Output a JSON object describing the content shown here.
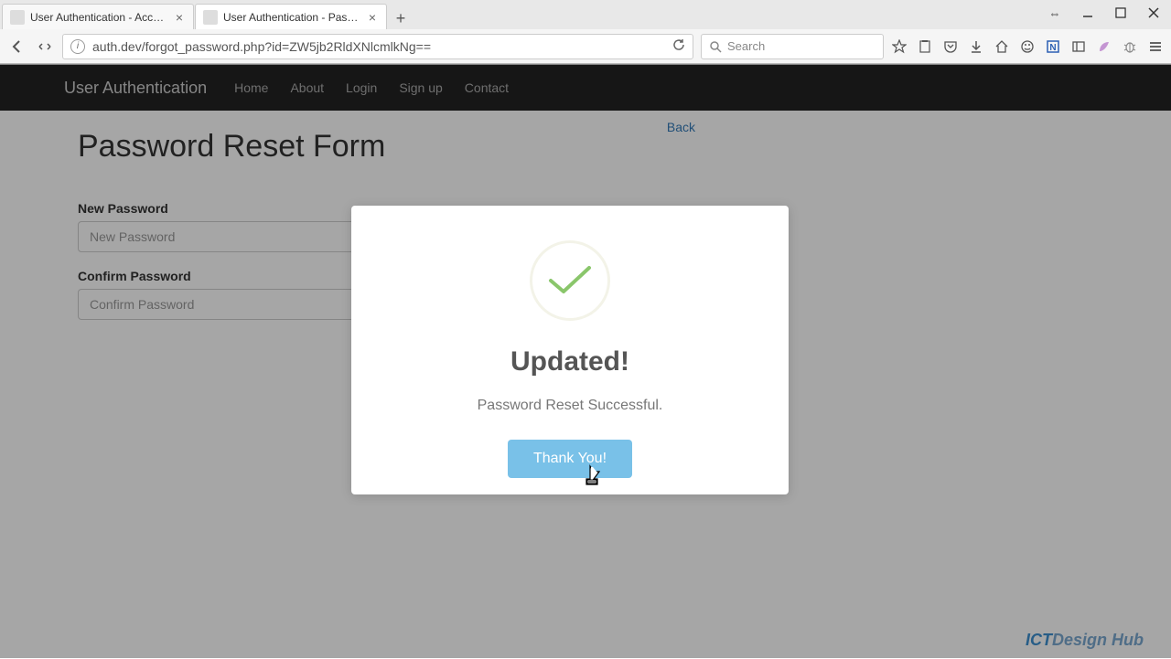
{
  "browser": {
    "tabs": [
      {
        "title": "User Authentication - Account..."
      },
      {
        "title": "User Authentication - Passwor..."
      }
    ],
    "url": "auth.dev/forgot_password.php?id=ZW5jb2RldXNlcmlkNg==",
    "search_placeholder": "Search"
  },
  "navbar": {
    "brand": "User Authentication",
    "links": [
      "Home",
      "About",
      "Login",
      "Sign up",
      "Contact"
    ]
  },
  "page": {
    "back": "Back",
    "title": "Password Reset Form",
    "fields": {
      "new_password": {
        "label": "New Password",
        "placeholder": "New Password"
      },
      "confirm_password": {
        "label": "Confirm Password",
        "placeholder": "Confirm Password"
      }
    }
  },
  "modal": {
    "title": "Updated!",
    "text": "Password Reset Successful.",
    "button": "Thank You!"
  },
  "watermark": {
    "p1": "ICT",
    "p2": "Design Hub"
  }
}
